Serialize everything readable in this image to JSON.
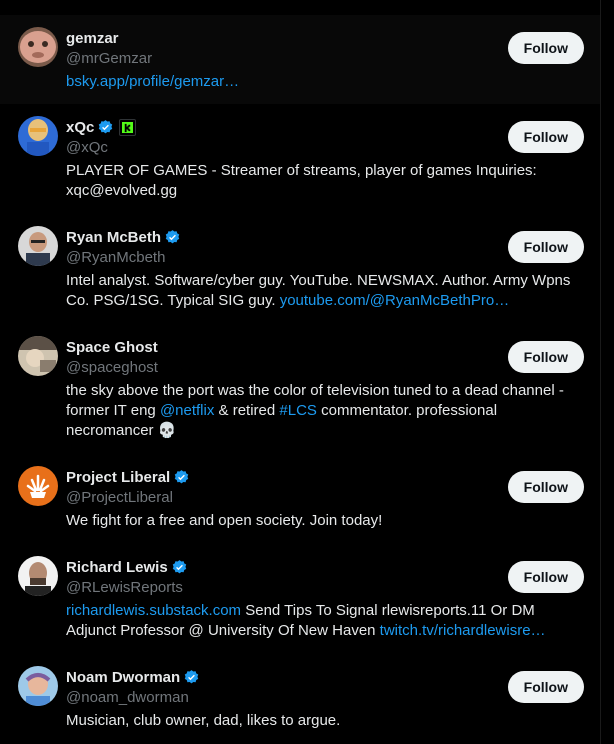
{
  "follow_label": "Follow",
  "accent_color": "#1d9bf0",
  "users": [
    {
      "name": "gemzar",
      "handle": "@mrGemzar",
      "verified": false,
      "bio_text": "",
      "bio_link": "bsky.app/profile/gemzar…"
    },
    {
      "name": "xQc",
      "handle": "@xQc",
      "verified": true,
      "affiliate_badge": "kick-k-icon",
      "bio_line1": "PLAYER OF GAMES - Streamer of streams, player of games Inquiries:",
      "bio_line2": "xqc@evolved.gg"
    },
    {
      "name": "Ryan McBeth",
      "handle": "@RyanMcbeth",
      "verified": true,
      "bio_line1": "Intel analyst. Software/cyber guy. YouTube. NEWSMAX. Author. Army Wpns",
      "bio_line2": "Co. PSG/1SG. Typical SIG guy.",
      "bio_link": "youtube.com/@RyanMcBethPro…"
    },
    {
      "name": "Space Ghost",
      "handle": "@spaceghost",
      "verified": false,
      "bio_line1": "the sky above the port was the color of television tuned to a dead channel -",
      "bio_line2a": "former IT eng",
      "bio_mention": "@netflix",
      "bio_line2b": "& retired",
      "bio_hashtag": "#LCS",
      "bio_line2c": "commentator. professional",
      "bio_line3": "necromancer",
      "bio_emoji": "💀"
    },
    {
      "name": "Project Liberal",
      "handle": "@ProjectLiberal",
      "verified": true,
      "bio_line1": "We fight for a free and open society. Join today!"
    },
    {
      "name": "Richard Lewis",
      "handle": "@RLewisReports",
      "verified": true,
      "bio_link1": "richardlewis.substack.com",
      "bio_line1": "Send Tips To Signal rlewisreports.11 Or DM",
      "bio_line2": "Adjunct Professor @ University Of New Haven",
      "bio_link2": "twitch.tv/richardlewisre…"
    },
    {
      "name": "Noam Dworman",
      "handle": "@noam_dworman",
      "verified": true,
      "bio_line1": "Musician, club owner, dad, likes to argue."
    }
  ]
}
